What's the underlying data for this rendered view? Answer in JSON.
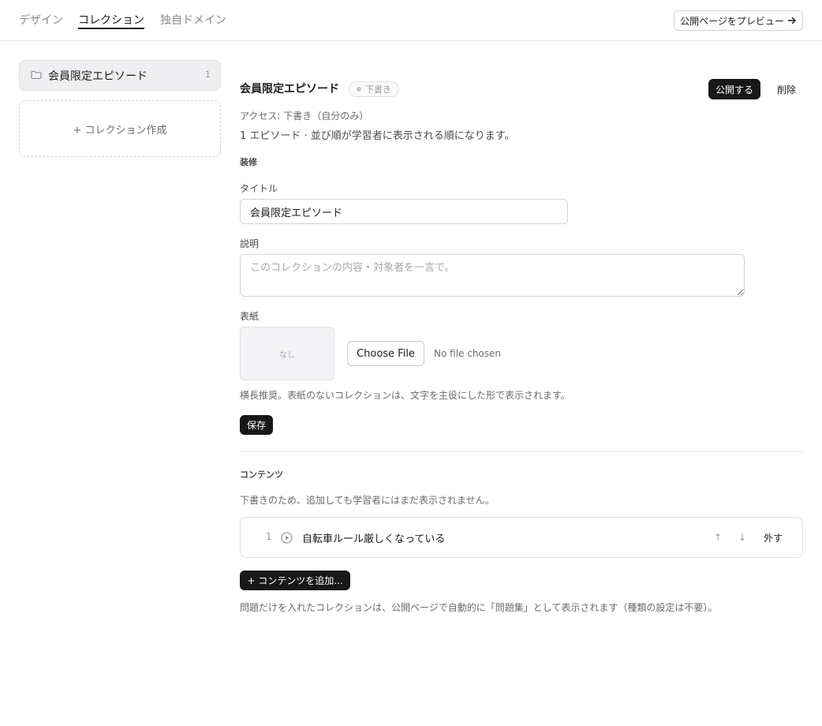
{
  "nav": {
    "tabs": [
      {
        "label": "デザイン",
        "active": false
      },
      {
        "label": "コレクション",
        "active": true
      },
      {
        "label": "独自ドメイン",
        "active": false
      }
    ],
    "preview_label": "公開ページをプレビュー",
    "preview_icon": "arrow-right-icon"
  },
  "sidebar": {
    "items": [
      {
        "label": "会員限定エピソード",
        "count": "1",
        "icon": "folder-icon"
      }
    ],
    "create_label": "+ コレクション作成"
  },
  "collection": {
    "title": "会員限定エピソード",
    "status_badge": "下書き",
    "publish_label": "公開する",
    "delete_label": "削除",
    "access": "アクセス: 下書き（自分のみ）",
    "episode_info": "1 エピソード · 並び順が学習者に表示される順になります。"
  },
  "decoration": {
    "section_label": "装修",
    "title_label": "タイトル",
    "title_value": "会員限定エピソード",
    "description_label": "説明",
    "description_placeholder": "このコレクションの内容・対象者を一言で。",
    "cover_label": "表紙",
    "cover_empty": "なし",
    "choose_file_label": "Choose File",
    "no_file_label": "No file chosen",
    "cover_hint": "横長推奨。表紙のないコレクションは、文字を主役にした形で表示されます。",
    "save_label": "保存"
  },
  "contents": {
    "section_label": "コンテンツ",
    "draft_note": "下書きのため、追加しても学習者にはまだ表示されません。",
    "items": [
      {
        "number": "1",
        "icon": "play-circle-icon",
        "title": "自転車ルール厳しくなっている",
        "up": "↑",
        "down": "↓",
        "remove_label": "外す"
      }
    ],
    "add_label": "+ コンテンツを追加...",
    "bottom_note": "問題だけを入れたコレクションは、公開ページで自動的に「問題集」として表示されます（種類の設定は不要）。"
  },
  "colors": {
    "primary_button": "#18181b",
    "border": "#e1e1e4",
    "muted_text": "#6b6b70"
  }
}
